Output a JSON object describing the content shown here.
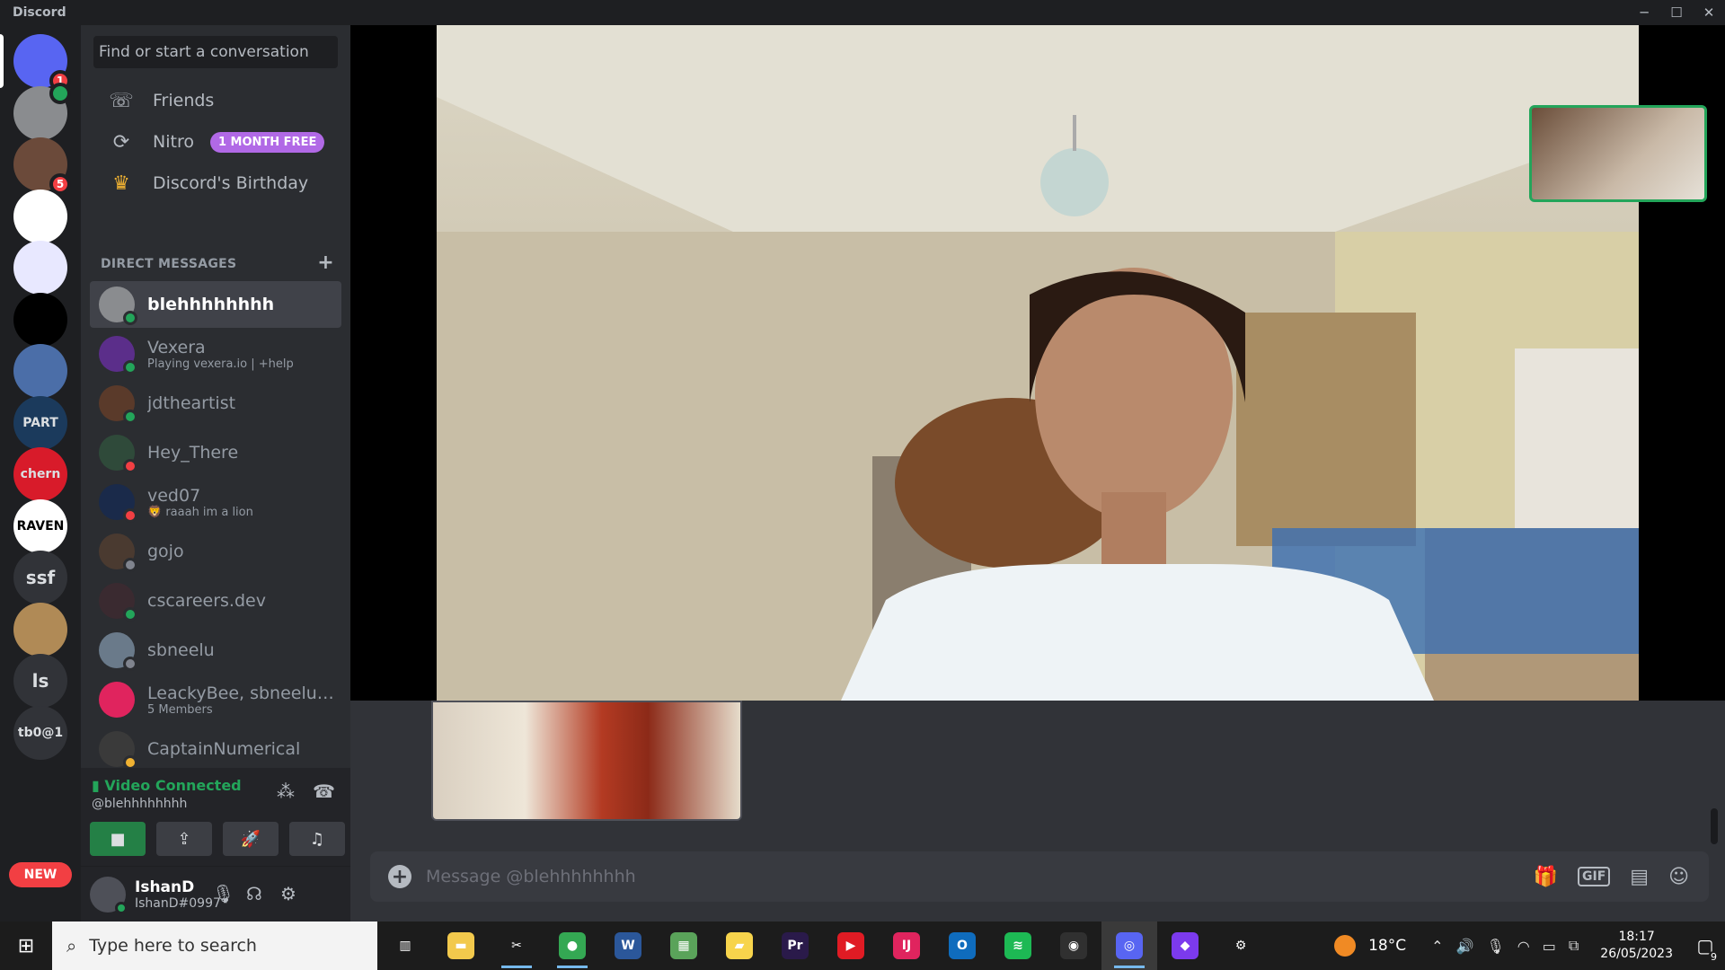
{
  "window": {
    "title": "Discord"
  },
  "servers": [
    {
      "id": "home",
      "label": "",
      "badge": "1",
      "color": "#5865f2"
    },
    {
      "id": "s1",
      "label": "",
      "badge": "",
      "color": "#8a8c8f",
      "voice": true
    },
    {
      "id": "s2",
      "label": "",
      "badge": "5",
      "color": "#6b4a3a"
    },
    {
      "id": "s3",
      "label": "",
      "badge": "",
      "color": "#ffffff"
    },
    {
      "id": "s4",
      "label": "",
      "badge": "",
      "color": "#e8e8ff"
    },
    {
      "id": "s5",
      "label": "",
      "badge": "",
      "color": "#000000"
    },
    {
      "id": "s6",
      "label": "",
      "badge": "",
      "color": "#4b6ea8"
    },
    {
      "id": "s7",
      "label": "PART",
      "badge": "",
      "color": "#1b3a5c"
    },
    {
      "id": "s8",
      "label": "chern",
      "badge": "",
      "color": "#d81b2a"
    },
    {
      "id": "s9",
      "label": "RAVEN",
      "badge": "",
      "color": "#ffffff"
    },
    {
      "id": "s10",
      "label": "ssf",
      "badge": "",
      "color": "#313338"
    },
    {
      "id": "s11",
      "label": "",
      "badge": "",
      "color": "#b08a56"
    },
    {
      "id": "s12",
      "label": "ls",
      "badge": "",
      "color": "#313338"
    },
    {
      "id": "s13",
      "label": "tb0@1",
      "badge": "",
      "color": "#313338"
    }
  ],
  "new_badge": "NEW",
  "dm_sidebar": {
    "search_placeholder": "Find or start a conversation",
    "nav": [
      {
        "label": "Friends",
        "icon": "friends-icon"
      },
      {
        "label": "Nitro",
        "icon": "nitro-icon",
        "badge": "1 MONTH FREE"
      },
      {
        "label": "Discord's Birthday",
        "icon": "cake-icon"
      }
    ],
    "section_title": "DIRECT MESSAGES",
    "dms": [
      {
        "name": "blehhhhhhhh",
        "sub": "",
        "status": "online",
        "active": true,
        "color": "#8a8c8f"
      },
      {
        "name": "Vexera",
        "sub": "Playing vexera.io | +help",
        "status": "online",
        "active": false,
        "color": "#5b2e8a"
      },
      {
        "name": "jdtheartist",
        "sub": "",
        "status": "online",
        "active": false,
        "color": "#5a3a2a"
      },
      {
        "name": "Hey_There",
        "sub": "",
        "status": "dnd",
        "active": false,
        "color": "#2f4a3a"
      },
      {
        "name": "ved07",
        "sub": "🦁 raaah im a lion",
        "status": "dnd",
        "active": false,
        "color": "#1a2a4a"
      },
      {
        "name": "gojo",
        "sub": "",
        "status": "offline",
        "active": false,
        "color": "#4a3a30"
      },
      {
        "name": "cscareers.dev",
        "sub": "",
        "status": "online",
        "active": false,
        "color": "#3a2a30"
      },
      {
        "name": "sbneelu",
        "sub": "",
        "status": "offline",
        "active": false,
        "color": "#6a7a8a"
      },
      {
        "name": "LeackyBee, sbneelu, s...",
        "sub": "5 Members",
        "status": "",
        "active": false,
        "color": "#e0245e"
      },
      {
        "name": "CaptainNumerical",
        "sub": "",
        "status": "idle",
        "active": false,
        "color": "#3a3a3a"
      }
    ]
  },
  "voice": {
    "status": "Video Connected",
    "channel": "@blehhhhhhhh"
  },
  "user": {
    "name": "IshanD",
    "tag": "IshanD#0997"
  },
  "chat": {
    "placeholder": "Message @blehhhhhhhh",
    "gif_label": "GIF"
  },
  "taskbar": {
    "search_placeholder": "Type here to search",
    "apps": [
      {
        "name": "task-view",
        "glyph": "▥",
        "color": "transparent",
        "run": false
      },
      {
        "name": "file-explorer",
        "glyph": "▬",
        "color": "#f2c94c",
        "run": false
      },
      {
        "name": "snipping-tool",
        "glyph": "✂",
        "color": "transparent",
        "run": true
      },
      {
        "name": "chrome",
        "glyph": "●",
        "color": "#34a853",
        "run": true
      },
      {
        "name": "word",
        "glyph": "W",
        "color": "#2b579a",
        "run": false
      },
      {
        "name": "excel",
        "glyph": "▦",
        "color": "#5aa35a",
        "run": false
      },
      {
        "name": "sticky-notes",
        "glyph": "▰",
        "color": "#f7d44c",
        "run": false
      },
      {
        "name": "premiere",
        "glyph": "Pr",
        "color": "#2a1a4a",
        "run": false
      },
      {
        "name": "youtube-music",
        "glyph": "▶",
        "color": "#e01b24",
        "run": false
      },
      {
        "name": "intellij",
        "glyph": "IJ",
        "color": "#e0245e",
        "run": false
      },
      {
        "name": "outlook",
        "glyph": "O",
        "color": "#0f6cbd",
        "run": false
      },
      {
        "name": "spotify",
        "glyph": "≋",
        "color": "#1db954",
        "run": false
      },
      {
        "name": "obs",
        "glyph": "◉",
        "color": "#303030",
        "run": false
      },
      {
        "name": "discord",
        "glyph": "◎",
        "color": "#5865f2",
        "run": true,
        "active": true
      },
      {
        "name": "obsidian",
        "glyph": "◆",
        "color": "#7c3aed",
        "run": false
      },
      {
        "name": "settings",
        "glyph": "⚙",
        "color": "transparent",
        "run": false
      }
    ],
    "weather": "18°C",
    "time": "18:17",
    "date": "26/05/2023",
    "notifications": "9"
  }
}
